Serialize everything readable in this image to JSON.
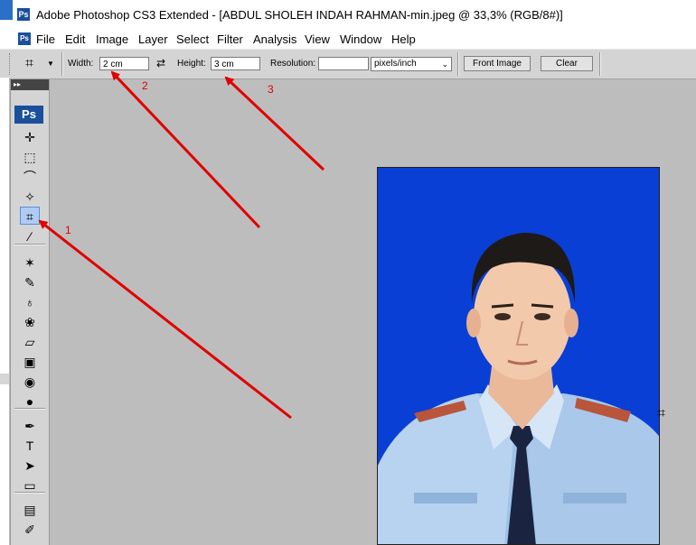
{
  "window": {
    "title": "Adobe Photoshop CS3 Extended - [ABDUL SHOLEH INDAH RAHMAN-min.jpeg @ 33,3% (RGB/8#)]",
    "logo_text": "Ps"
  },
  "menubar": {
    "items": [
      {
        "label": "File"
      },
      {
        "label": "Edit"
      },
      {
        "label": "Image"
      },
      {
        "label": "Layer"
      },
      {
        "label": "Select"
      },
      {
        "label": "Filter"
      },
      {
        "label": "Analysis"
      },
      {
        "label": "View"
      },
      {
        "label": "Window"
      },
      {
        "label": "Help"
      }
    ]
  },
  "options_bar": {
    "tool_preset_icon": "crop-icon",
    "width_label": "Width:",
    "width_value": "2 cm",
    "height_label": "Height:",
    "height_value": "3 cm",
    "resolution_label": "Resolution:",
    "resolution_value": "",
    "resolution_unit": "pixels/inch",
    "front_image_label": "Front Image",
    "clear_label": "Clear"
  },
  "toolbox": {
    "header": "▸▸",
    "logo_text": "Ps",
    "tools": [
      {
        "name": "move-tool",
        "glyph": "✛"
      },
      {
        "name": "marquee-tool",
        "glyph": "⬚"
      },
      {
        "name": "lasso-tool",
        "glyph": "⌒"
      },
      {
        "name": "magic-wand-tool",
        "glyph": "✧"
      },
      {
        "name": "crop-tool",
        "glyph": "⌗",
        "selected": true
      },
      {
        "name": "slice-tool",
        "glyph": "∕"
      },
      {
        "name": "healing-brush-tool",
        "glyph": "✶"
      },
      {
        "name": "brush-tool",
        "glyph": "✎"
      },
      {
        "name": "clone-stamp-tool",
        "glyph": "♁"
      },
      {
        "name": "history-brush-tool",
        "glyph": "❀"
      },
      {
        "name": "eraser-tool",
        "glyph": "▱"
      },
      {
        "name": "gradient-tool",
        "glyph": "▣"
      },
      {
        "name": "blur-tool",
        "glyph": "◉"
      },
      {
        "name": "dodge-tool",
        "glyph": "●"
      },
      {
        "name": "pen-tool",
        "glyph": "✒"
      },
      {
        "name": "type-tool",
        "glyph": "T"
      },
      {
        "name": "path-selection-tool",
        "glyph": "➤"
      },
      {
        "name": "rectangle-tool",
        "glyph": "▭"
      },
      {
        "name": "notes-tool",
        "glyph": "▤"
      },
      {
        "name": "eyedropper-tool",
        "glyph": "✐"
      }
    ]
  },
  "annotations": {
    "label_1": "1",
    "label_2": "2",
    "label_3": "3",
    "color": "#e00000"
  },
  "colors": {
    "photo_background": "#0a3fd6",
    "canvas_background": "#bdbdbd",
    "selected_tool": "#aeccf2"
  }
}
